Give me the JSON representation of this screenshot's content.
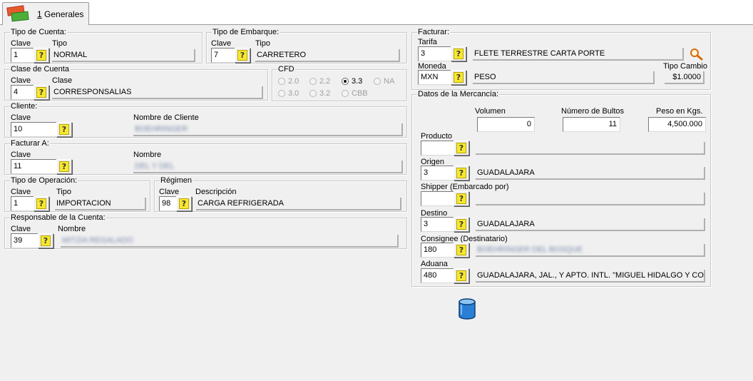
{
  "tab": {
    "number": "1",
    "label": "Generales"
  },
  "tipo_cuenta": {
    "title": "Tipo de Cuenta:",
    "clave_label": "Clave",
    "tipo_label": "Tipo",
    "clave": "1",
    "tipo": "NORMAL"
  },
  "tipo_embarque": {
    "title": "Tipo de Embarque:",
    "clave_label": "Clave",
    "tipo_label": "Tipo",
    "clave": "7",
    "tipo": "CARRETERO"
  },
  "clase_cuenta": {
    "title": "Clase de Cuenta",
    "clave_label": "Clave",
    "clase_label": "Clase",
    "clave": "4",
    "clase": "CORRESPONSALIAS"
  },
  "cfd": {
    "title": "CFD",
    "options": [
      "2.0",
      "2.2",
      "3.3",
      "NA",
      "3.0",
      "3.2",
      "CBB"
    ],
    "selected": "3.3"
  },
  "cliente": {
    "title": "Cliente:",
    "clave_label": "Clave",
    "nombre_label": "Nombre de Cliente",
    "clave": "10",
    "nombre": "BOEHRINGER"
  },
  "facturar_a": {
    "title": "Facturar A:",
    "clave_label": "Clave",
    "nombre_label": "Nombre",
    "clave": "11",
    "nombre": "DEL Y DEL"
  },
  "tipo_operacion": {
    "title": "Tipo de Operación:",
    "clave_label": "Clave",
    "tipo_label": "Tipo",
    "clave": "1",
    "tipo": "IMPORTACION"
  },
  "regimen": {
    "title": "Régimen",
    "clave_label": "Clave",
    "desc_label": "Descripción",
    "clave": "98",
    "descripcion": "CARGA REFRIGERADA"
  },
  "responsable": {
    "title": "Responsable de la Cuenta:",
    "clave_label": "Clave",
    "nombre_label": "Nombre",
    "clave": "39",
    "nombre": "MITZIA REGALADO"
  },
  "facturar": {
    "title": "Facturar:",
    "tarifa_label": "Tarifa",
    "tarifa_clave": "3",
    "tarifa": "FLETE TERRESTRE CARTA PORTE",
    "moneda_label": "Moneda",
    "moneda_clave": "MXN",
    "moneda": "PESO",
    "tipo_cambio_label": "Tipo Cambio",
    "tipo_cambio": "$1.0000"
  },
  "mercancia": {
    "title": "Datos de la Mercancía:",
    "volumen_label": "Volumen",
    "volumen": "0",
    "bultos_label": "Número de Bultos",
    "bultos": "11",
    "peso_label": "Peso en Kgs.",
    "peso": "4,500.000",
    "producto_label": "Producto",
    "producto_clave": "",
    "producto": "",
    "origen_label": "Origen",
    "origen_clave": "3",
    "origen": "GUADALAJARA",
    "shipper_label": "Shipper (Embarcado por)",
    "shipper_clave": "",
    "shipper": "",
    "destino_label": "Destino",
    "destino_clave": "3",
    "destino": "GUADALAJARA",
    "consignee_label": "Consignee (Destinatario)",
    "consignee_clave": "180",
    "consignee": "BOEHRINGER DEL BOSQUE",
    "aduana_label": "Aduana",
    "aduana_clave": "480",
    "aduana": "GUADALAJARA, JAL., Y APTO. INTL. \"MIGUEL HIDALGO Y COS"
  },
  "icons": {
    "tab": "cards-icon",
    "search": "magnifier-icon",
    "database": "database-icon",
    "help": "question-icon"
  },
  "colors": {
    "panel": "#f0f0f0",
    "help_yellow": "#f7e830",
    "db_blue": "#2a7fd4"
  }
}
